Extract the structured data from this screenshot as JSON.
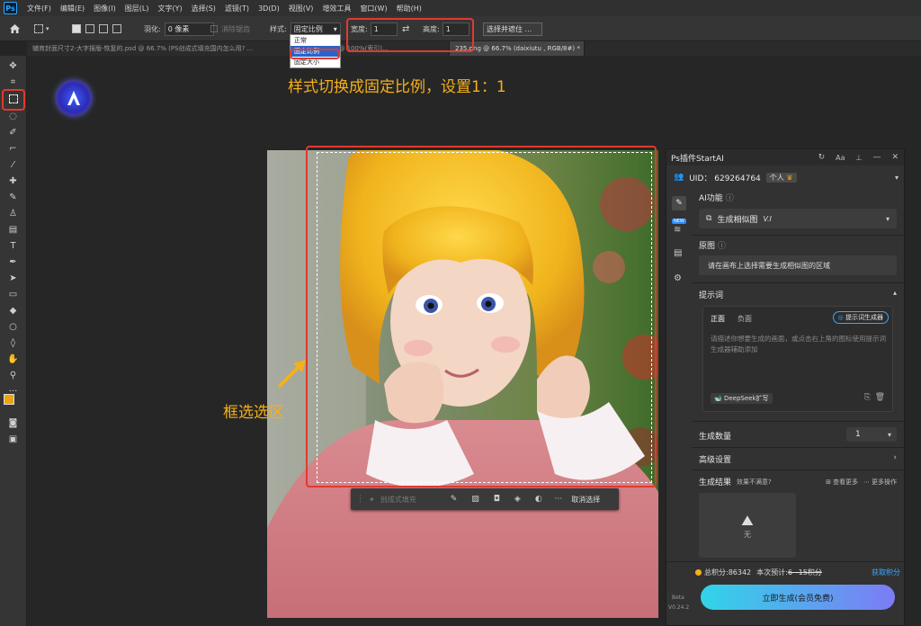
{
  "menubar": {
    "items": [
      "文件(F)",
      "编辑(E)",
      "图像(I)",
      "图层(L)",
      "文字(Y)",
      "选择(S)",
      "滤镜(T)",
      "3D(D)",
      "视图(V)",
      "增效工具",
      "窗口(W)",
      "帮助(H)"
    ]
  },
  "options": {
    "feather_label": "羽化:",
    "feather_value": "0 像素",
    "antialias_label": "消除锯齿",
    "style_label": "样式:",
    "style_value": "固定比例",
    "width_label": "宽度:",
    "width_value": "1",
    "height_label": "高度:",
    "height_value": "1",
    "select_mask_label": "选择并遮住 ..."
  },
  "style_dropdown": {
    "options": [
      "正常",
      "固定比例",
      "固定大小"
    ],
    "selected_index": 1
  },
  "tabs": [
    {
      "label": "辅育封面尺寸2-大字报版-恢复的.psd @ 66.7% (PS创成式填充国内怎么用? ...",
      "active": false
    },
    {
      "label": "...rnag.png @ 100%(索引)...",
      "active": false
    },
    {
      "label": "235.png @ 66.7% (daixiutu , RGB/8#) *",
      "active": true
    }
  ],
  "annotations": {
    "top": "样式切换成固定比例，设置1：1",
    "left": "框选选区"
  },
  "selection_bar": {
    "generative_fill": "创成式填充",
    "deselect": "取消选择"
  },
  "panel": {
    "title": "Ps插件StartAI",
    "header_icons": [
      "refresh-icon",
      "font-size-icon",
      "pin-icon",
      "minimize-icon",
      "close-icon"
    ],
    "uid": "UID： 629264764",
    "account_badge": "个人",
    "ai_function_label": "AI功能",
    "ai_function_value": "生成相似图",
    "ai_function_version": "V.I",
    "side_badge": "NEW",
    "source_label": "原图",
    "source_hint": "请在画布上选择需要生成相似图的区域",
    "prompt_label": "提示词",
    "prompt_tab_positive": "正面",
    "prompt_tab_negative": "负面",
    "prompt_generator_label": "提示词生成器",
    "prompt_placeholder": "请描述你想要生成的画面，或点击右上角的图标使用提示词生成器辅助添加",
    "deepseek_label": "DeepSeek扩写",
    "count_label": "生成数量",
    "count_value": "1",
    "advanced_label": "高级设置",
    "results_label": "生成结果",
    "results_unsatisfied": "效果不满意?",
    "results_view_more": "查看更多",
    "results_more_actions": "更多操作",
    "result_placeholder": "无",
    "points_label": "总积分:86342",
    "estimate_label": "本次预计:",
    "estimate_value": "6~15积分",
    "get_points": "获取积分",
    "generate_button": "立即生成(会员免费)",
    "beta_label": "Beta",
    "version_label": "V0.24.2"
  },
  "colors": {
    "accent": "#31a8ff",
    "annotation": "#f5b01b",
    "highlight": "#e03a2f",
    "generate_start": "#30d5e8",
    "generate_end": "#7d7bf5",
    "foreground": "#f0a30a",
    "background": "#000000"
  }
}
